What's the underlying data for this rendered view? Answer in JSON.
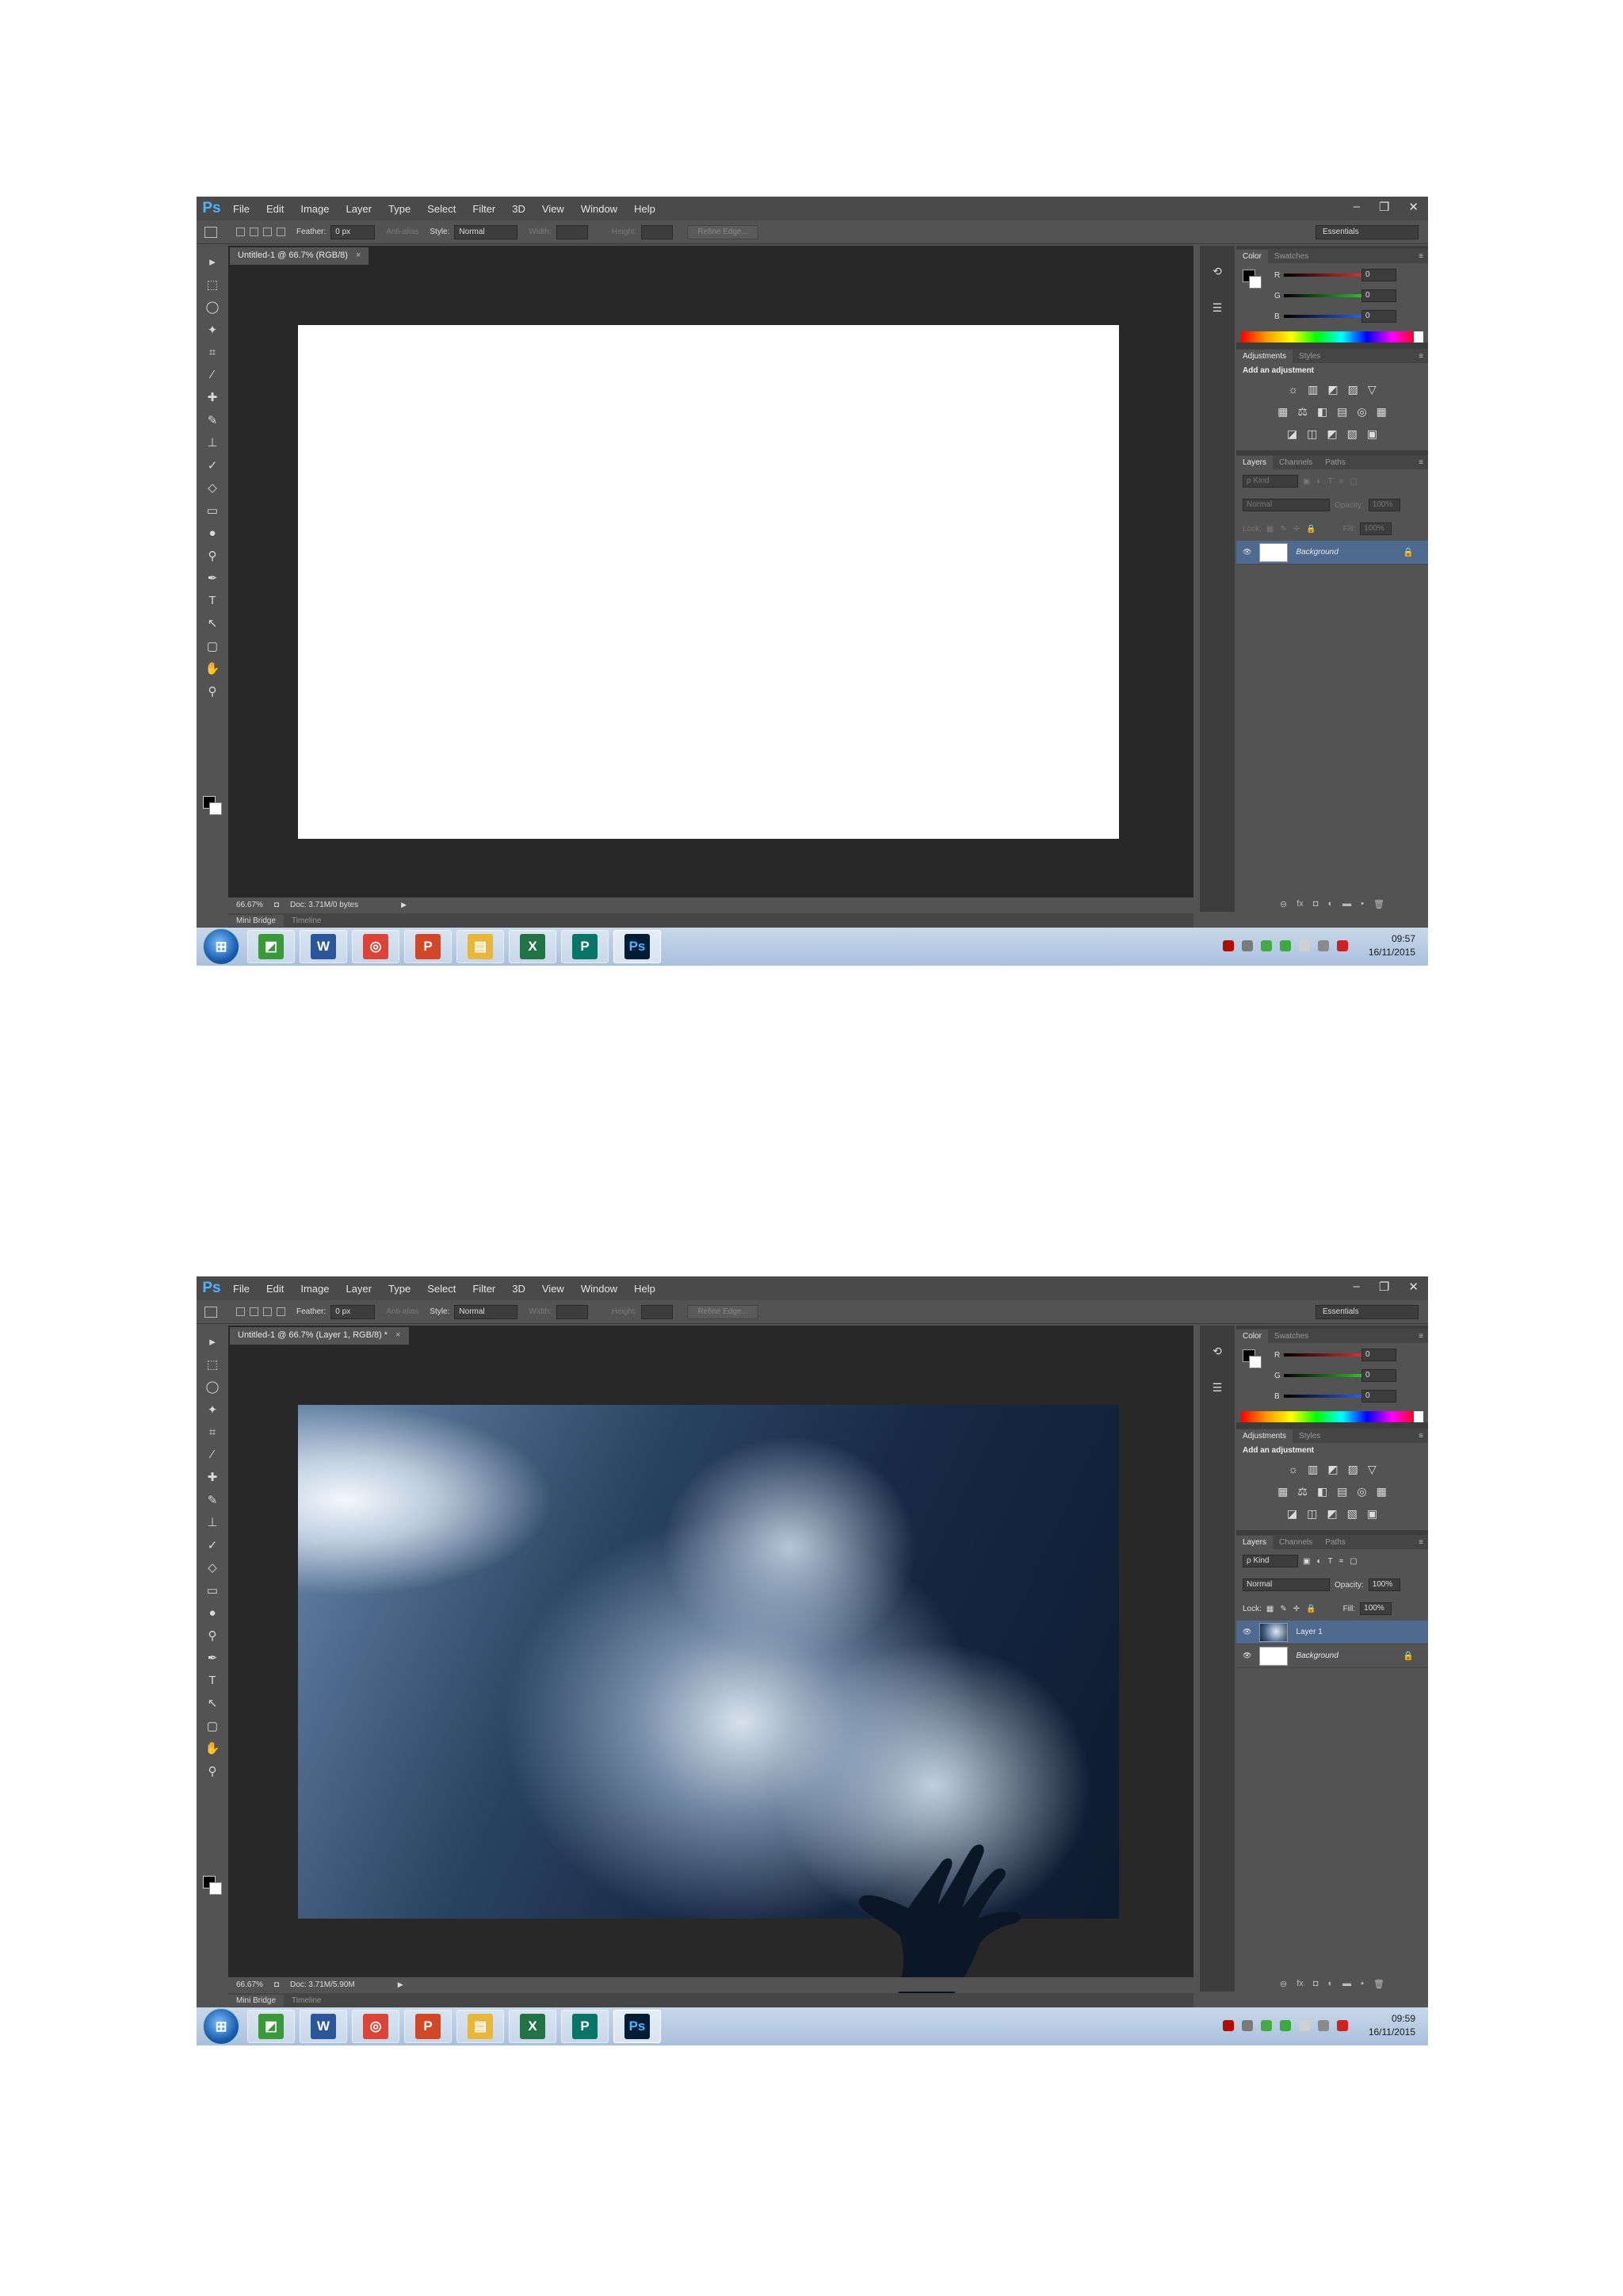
{
  "menu": [
    "File",
    "Edit",
    "Image",
    "Layer",
    "Type",
    "Select",
    "Filter",
    "3D",
    "View",
    "Window",
    "Help"
  ],
  "app_logo": "Ps",
  "window_controls": [
    "–",
    "❐",
    "✕"
  ],
  "options": {
    "feather_label": "Feather:",
    "feather_value": "0 px",
    "antialias_label": "Anti-alias",
    "style_label": "Style:",
    "style_value": "Normal",
    "width_label": "Width:",
    "height_label": "Height:",
    "refine_edge": "Refine Edge...",
    "workspace": "Essentials"
  },
  "tools": [
    "▸",
    "⬚",
    "◯",
    "✦",
    "⌗",
    "⁄",
    "✚",
    "✎",
    "⊥",
    "✓",
    "◇",
    "▭",
    "●",
    "⚲",
    "✒",
    "T",
    "↖",
    "▢",
    "✋",
    "⚲"
  ],
  "color_panel": {
    "tabs": [
      "Color",
      "Swatches"
    ],
    "rows": [
      {
        "label": "R",
        "value": "0",
        "color": "#e03030"
      },
      {
        "label": "G",
        "value": "0",
        "color": "#30c030"
      },
      {
        "label": "B",
        "value": "0",
        "color": "#3060e0"
      }
    ]
  },
  "adjustments_panel": {
    "tabs": [
      "Adjustments",
      "Styles"
    ],
    "title": "Add an adjustment",
    "rows": [
      [
        "☼",
        "▥",
        "◩",
        "▨",
        "▽"
      ],
      [
        "▦",
        "⚖",
        "◧",
        "▤",
        "◎",
        "▦"
      ],
      [
        "◪",
        "◫",
        "◩",
        "▧",
        "▣"
      ]
    ]
  },
  "layers_panel": {
    "tabs": [
      "Layers",
      "Channels",
      "Paths"
    ],
    "kind_label": "ρ Kind",
    "blend_mode": "Normal",
    "opacity_label": "Opacity:",
    "fill_label": "Fill:",
    "lock_label": "Lock:",
    "footer": [
      "⊖",
      "fx",
      "◘",
      "◐",
      "▬",
      "▪",
      "🗑"
    ]
  },
  "screens": [
    {
      "doc_tab": "Untitled-1 @ 66.7% (RGB/8)",
      "status_zoom": "66.67%",
      "status_doc": "Doc: 3.71M/0 bytes",
      "canvas_type": "blank",
      "opacity_value": "100%",
      "fill_value": "100%",
      "controls_dim": true,
      "layers": [
        {
          "name": "Background",
          "thumb": "white",
          "locked": true,
          "selected": true
        }
      ],
      "clock_time": "09:57",
      "clock_date": "16/11/2015"
    },
    {
      "doc_tab": "Untitled-1 @ 66.7% (Layer 1, RGB/8) *",
      "status_zoom": "66.67%",
      "status_doc": "Doc: 3.71M/5.90M",
      "canvas_type": "photo",
      "opacity_value": "100%",
      "fill_value": "100%",
      "controls_dim": false,
      "layers": [
        {
          "name": "Layer 1",
          "thumb": "photo",
          "locked": false,
          "selected": true
        },
        {
          "name": "Background",
          "thumb": "white",
          "locked": true,
          "selected": false
        }
      ],
      "clock_time": "09:59",
      "clock_date": "16/11/2015"
    }
  ],
  "bottom_tabs": [
    "Mini Bridge",
    "Timeline"
  ],
  "taskbar_apps": [
    {
      "name": "photos",
      "glyph": "◩",
      "color": "#3a9a3a"
    },
    {
      "name": "word",
      "glyph": "W",
      "color": "#2b579a"
    },
    {
      "name": "chrome",
      "glyph": "◎",
      "color": "#db4437"
    },
    {
      "name": "powerpoint",
      "glyph": "P",
      "color": "#d24726"
    },
    {
      "name": "explorer",
      "glyph": "▤",
      "color": "#e8b73a"
    },
    {
      "name": "excel",
      "glyph": "X",
      "color": "#217346"
    },
    {
      "name": "publisher",
      "glyph": "P",
      "color": "#077568"
    },
    {
      "name": "photoshop",
      "glyph": "Ps",
      "color": "#001d34"
    }
  ],
  "tray_icons": [
    {
      "name": "acrobat",
      "color": "#b30b00"
    },
    {
      "name": "network",
      "color": "#7a7a7a"
    },
    {
      "name": "security",
      "color": "#44aa44"
    },
    {
      "name": "update",
      "color": "#3aaa3a"
    },
    {
      "name": "flag",
      "color": "#d0d0d0"
    },
    {
      "name": "volume",
      "color": "#8a8a8a"
    },
    {
      "name": "error",
      "color": "#d02020"
    }
  ]
}
